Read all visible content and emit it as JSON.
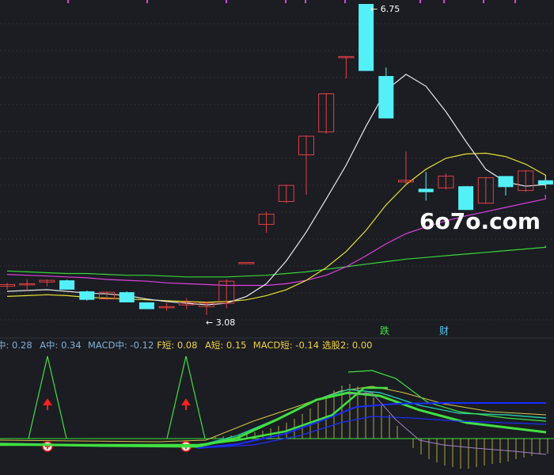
{
  "watermark": "6o7o.com",
  "labels": {
    "high_price": "6.75",
    "low_price": "3.08",
    "sig_die": "跌",
    "sig_cai": "财"
  },
  "indicator_line": [
    {
      "text": "中: 0.28",
      "color": "#7fb0d8"
    },
    {
      "text": "A中: 0.34",
      "color": "#7fb0d8"
    },
    {
      "text": "MACD中: -0.12",
      "color": "#7fb0d8"
    },
    {
      "text": "F短: 0.08",
      "color": "#f0d040"
    },
    {
      "text": "A短: 0.15",
      "color": "#f0d040"
    },
    {
      "text": "MACD短: -0.14",
      "color": "#f0d040"
    },
    {
      "text": "选股2: 0.00",
      "color": "#f0d040"
    }
  ],
  "colors": {
    "background": "#1b1d23",
    "up_candle": "#e04040",
    "down_candle": "#54f0f8",
    "ma_white": "#e8e8e8",
    "ma_yellow": "#e8e030",
    "ma_magenta": "#e040e0",
    "ma_green": "#3ad63a",
    "signal_green": "#40e040",
    "blue_line": "#1a2cff",
    "teal_line": "#22a8a8",
    "marker_red": "#ff2020"
  },
  "chart_data": {
    "type": "candlestick",
    "price_min": 3.08,
    "price_max": 6.75,
    "candles": [
      {
        "o": 3.42,
        "h": 3.46,
        "l": 3.38,
        "c": 3.44
      },
      {
        "o": 3.44,
        "h": 3.5,
        "l": 3.37,
        "c": 3.45
      },
      {
        "o": 3.47,
        "h": 3.5,
        "l": 3.42,
        "c": 3.49
      },
      {
        "o": 3.49,
        "h": 3.5,
        "l": 3.38,
        "c": 3.38
      },
      {
        "o": 3.36,
        "h": 3.37,
        "l": 3.25,
        "c": 3.26
      },
      {
        "o": 3.27,
        "h": 3.36,
        "l": 3.26,
        "c": 3.35
      },
      {
        "o": 3.35,
        "h": 3.36,
        "l": 3.23,
        "c": 3.23
      },
      {
        "o": 3.23,
        "h": 3.23,
        "l": 3.15,
        "c": 3.15
      },
      {
        "o": 3.18,
        "h": 3.22,
        "l": 3.13,
        "c": 3.18
      },
      {
        "o": 3.2,
        "h": 3.28,
        "l": 3.15,
        "c": 3.23
      },
      {
        "o": 3.18,
        "h": 3.24,
        "l": 3.08,
        "c": 3.22
      },
      {
        "o": 3.22,
        "h": 3.5,
        "l": 3.16,
        "c": 3.48
      },
      {
        "o": 3.7,
        "h": 3.7,
        "l": 3.7,
        "c": 3.7
      },
      {
        "o": 4.15,
        "h": 4.3,
        "l": 4.05,
        "c": 4.27
      },
      {
        "o": 4.42,
        "h": 4.62,
        "l": 4.4,
        "c": 4.61
      },
      {
        "o": 4.97,
        "h": 5.2,
        "l": 4.5,
        "c": 5.19
      },
      {
        "o": 5.24,
        "h": 5.7,
        "l": 5.22,
        "c": 5.69
      },
      {
        "o": 6.13,
        "h": 6.13,
        "l": 5.87,
        "c": 6.13
      },
      {
        "o": 6.75,
        "h": 6.75,
        "l": 5.96,
        "c": 5.96
      },
      {
        "o": 5.9,
        "h": 6.0,
        "l": 5.4,
        "c": 5.4
      },
      {
        "o": 4.65,
        "h": 5.01,
        "l": 4.63,
        "c": 4.67
      },
      {
        "o": 4.57,
        "h": 4.77,
        "l": 4.43,
        "c": 4.53
      },
      {
        "o": 4.58,
        "h": 4.75,
        "l": 4.56,
        "c": 4.72
      },
      {
        "o": 4.6,
        "h": 4.6,
        "l": 4.32,
        "c": 4.32
      },
      {
        "o": 4.4,
        "h": 4.71,
        "l": 4.39,
        "c": 4.7
      },
      {
        "o": 4.72,
        "h": 4.72,
        "l": 4.49,
        "c": 4.59
      },
      {
        "o": 4.55,
        "h": 4.79,
        "l": 4.53,
        "c": 4.78
      },
      {
        "o": 4.67,
        "h": 4.7,
        "l": 4.57,
        "c": 4.62
      }
    ],
    "ma_white": [
      3.36,
      3.37,
      3.38,
      3.36,
      3.34,
      3.33,
      3.31,
      3.27,
      3.24,
      3.22,
      3.2,
      3.22,
      3.3,
      3.45,
      3.72,
      4.06,
      4.45,
      4.85,
      5.31,
      5.73,
      5.92,
      5.78,
      5.48,
      5.13,
      4.8,
      4.65,
      4.6,
      4.62
    ],
    "ma_yellow": [
      3.3,
      3.31,
      3.32,
      3.31,
      3.29,
      3.28,
      3.27,
      3.26,
      3.25,
      3.24,
      3.23,
      3.24,
      3.26,
      3.31,
      3.38,
      3.49,
      3.64,
      3.83,
      4.08,
      4.38,
      4.62,
      4.8,
      4.93,
      4.98,
      4.99,
      4.95,
      4.86,
      4.73
    ],
    "ma_magenta": [
      3.56,
      3.55,
      3.54,
      3.53,
      3.52,
      3.5,
      3.49,
      3.48,
      3.46,
      3.45,
      3.44,
      3.43,
      3.43,
      3.43,
      3.45,
      3.49,
      3.55,
      3.65,
      3.78,
      3.92,
      4.04,
      4.12,
      4.19,
      4.25,
      4.3,
      4.35,
      4.4,
      4.45
    ],
    "ma_green": [
      3.6,
      3.59,
      3.58,
      3.57,
      3.57,
      3.56,
      3.55,
      3.55,
      3.54,
      3.53,
      3.53,
      3.53,
      3.54,
      3.55,
      3.57,
      3.59,
      3.62,
      3.65,
      3.68,
      3.71,
      3.74,
      3.76,
      3.78,
      3.8,
      3.82,
      3.84,
      3.86,
      3.88
    ]
  }
}
